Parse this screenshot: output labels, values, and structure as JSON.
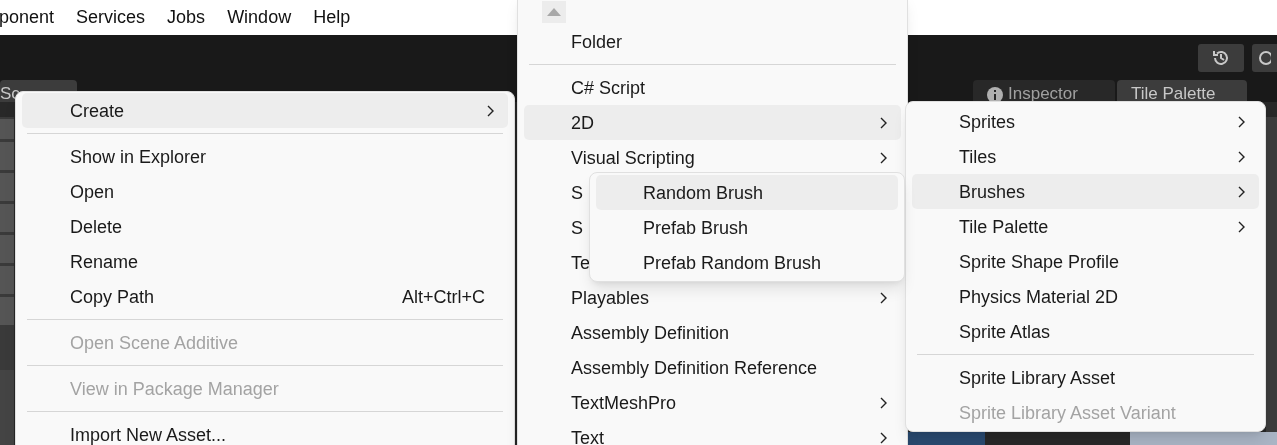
{
  "menu_bar": {
    "items": [
      "ponent",
      "Services",
      "Jobs",
      "Window",
      "Help"
    ]
  },
  "left_tabs": [
    {
      "label": "Sc",
      "selected": true
    }
  ],
  "right_tabs": [
    {
      "label": "Inspector",
      "selected": false
    },
    {
      "label": "Tile Palette",
      "selected": true
    }
  ],
  "context_menu": {
    "items": [
      {
        "kind": "item",
        "label": "Create",
        "submenu": true,
        "selected": true,
        "disabled": false
      },
      {
        "kind": "separator"
      },
      {
        "kind": "item",
        "label": "Show in Explorer",
        "submenu": false,
        "selected": false,
        "disabled": false
      },
      {
        "kind": "item",
        "label": "Open",
        "submenu": false,
        "selected": false,
        "disabled": false
      },
      {
        "kind": "item",
        "label": "Delete",
        "submenu": false,
        "selected": false,
        "disabled": false
      },
      {
        "kind": "item",
        "label": "Rename",
        "submenu": false,
        "selected": false,
        "disabled": false
      },
      {
        "kind": "item",
        "label": "Copy Path",
        "shortcut": "Alt+Ctrl+C",
        "submenu": false,
        "selected": false,
        "disabled": false
      },
      {
        "kind": "separator"
      },
      {
        "kind": "item",
        "label": "Open Scene Additive",
        "submenu": false,
        "selected": false,
        "disabled": true
      },
      {
        "kind": "separator"
      },
      {
        "kind": "item",
        "label": "View in Package Manager",
        "submenu": false,
        "selected": false,
        "disabled": true
      },
      {
        "kind": "separator"
      },
      {
        "kind": "item",
        "label": "Import New Asset...",
        "submenu": false,
        "selected": false,
        "disabled": false
      }
    ]
  },
  "create_submenu": {
    "items": [
      {
        "kind": "item",
        "label": "Folder",
        "submenu": false,
        "selected": false,
        "disabled": false
      },
      {
        "kind": "separator"
      },
      {
        "kind": "item",
        "label": "C# Script",
        "submenu": false,
        "selected": false,
        "disabled": false
      },
      {
        "kind": "item",
        "label": "2D",
        "submenu": true,
        "selected": true,
        "disabled": false
      },
      {
        "kind": "item",
        "label": "Visual Scripting",
        "submenu": true,
        "selected": false,
        "disabled": false
      },
      {
        "kind": "item",
        "label": "S",
        "submenu": false,
        "selected": false,
        "disabled": false
      },
      {
        "kind": "item",
        "label": "S",
        "submenu": false,
        "selected": false,
        "disabled": false
      },
      {
        "kind": "item",
        "label": "Te",
        "submenu": false,
        "selected": false,
        "disabled": false
      },
      {
        "kind": "item",
        "label": "Playables",
        "submenu": true,
        "selected": false,
        "disabled": false
      },
      {
        "kind": "item",
        "label": "Assembly Definition",
        "submenu": false,
        "selected": false,
        "disabled": false
      },
      {
        "kind": "item",
        "label": "Assembly Definition Reference",
        "submenu": false,
        "selected": false,
        "disabled": false
      },
      {
        "kind": "item",
        "label": "TextMeshPro",
        "submenu": true,
        "selected": false,
        "disabled": false
      },
      {
        "kind": "item",
        "label": "Text",
        "submenu": true,
        "selected": false,
        "disabled": false
      }
    ]
  },
  "submenu_2d": {
    "items": [
      {
        "kind": "item",
        "label": "Sprites",
        "submenu": true,
        "selected": false,
        "disabled": false
      },
      {
        "kind": "item",
        "label": "Tiles",
        "submenu": true,
        "selected": false,
        "disabled": false
      },
      {
        "kind": "item",
        "label": "Brushes",
        "submenu": true,
        "selected": true,
        "disabled": false
      },
      {
        "kind": "item",
        "label": "Tile Palette",
        "submenu": true,
        "selected": false,
        "disabled": false
      },
      {
        "kind": "item",
        "label": "Sprite Shape Profile",
        "submenu": false,
        "selected": false,
        "disabled": false
      },
      {
        "kind": "item",
        "label": "Physics Material 2D",
        "submenu": false,
        "selected": false,
        "disabled": false
      },
      {
        "kind": "item",
        "label": "Sprite Atlas",
        "submenu": false,
        "selected": false,
        "disabled": false
      },
      {
        "kind": "separator"
      },
      {
        "kind": "item",
        "label": "Sprite Library Asset",
        "submenu": false,
        "selected": false,
        "disabled": false
      },
      {
        "kind": "item",
        "label": "Sprite Library Asset Variant",
        "submenu": false,
        "selected": false,
        "disabled": true
      }
    ]
  },
  "brushes_submenu": {
    "items": [
      {
        "kind": "item",
        "label": "Random Brush",
        "submenu": false,
        "selected": true,
        "disabled": false
      },
      {
        "kind": "item",
        "label": "Prefab Brush",
        "submenu": false,
        "selected": false,
        "disabled": false
      },
      {
        "kind": "item",
        "label": "Prefab Random Brush",
        "submenu": false,
        "selected": false,
        "disabled": false
      }
    ]
  }
}
